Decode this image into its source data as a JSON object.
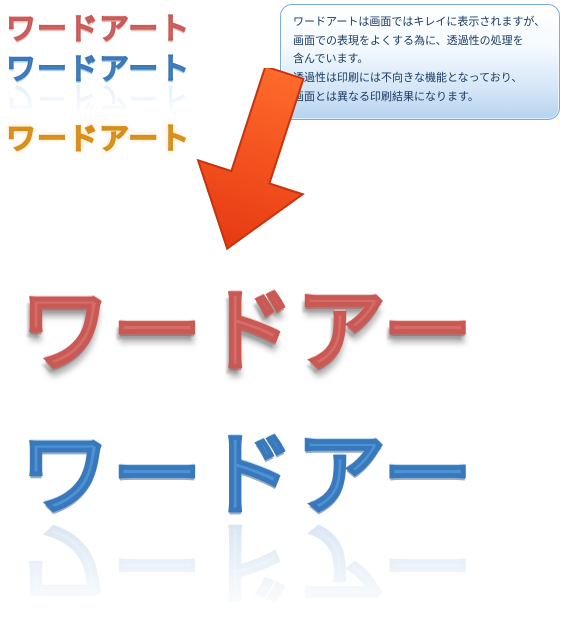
{
  "wordart": {
    "small1": "ワードアート",
    "small2": "ワードアート",
    "small3": "ワードアート",
    "big1": "ワードアー",
    "big2": "ワードアー"
  },
  "callout": {
    "line1": "ワードアートは画面ではキレイに表示されますが、",
    "line2": "画面での表現をよくする為に、透過性の処理を",
    "line3": "含んでいます。",
    "line4": "透過性は印刷には不向きな機能となっており、",
    "line5": "画面とは異なる印刷結果になります。"
  }
}
